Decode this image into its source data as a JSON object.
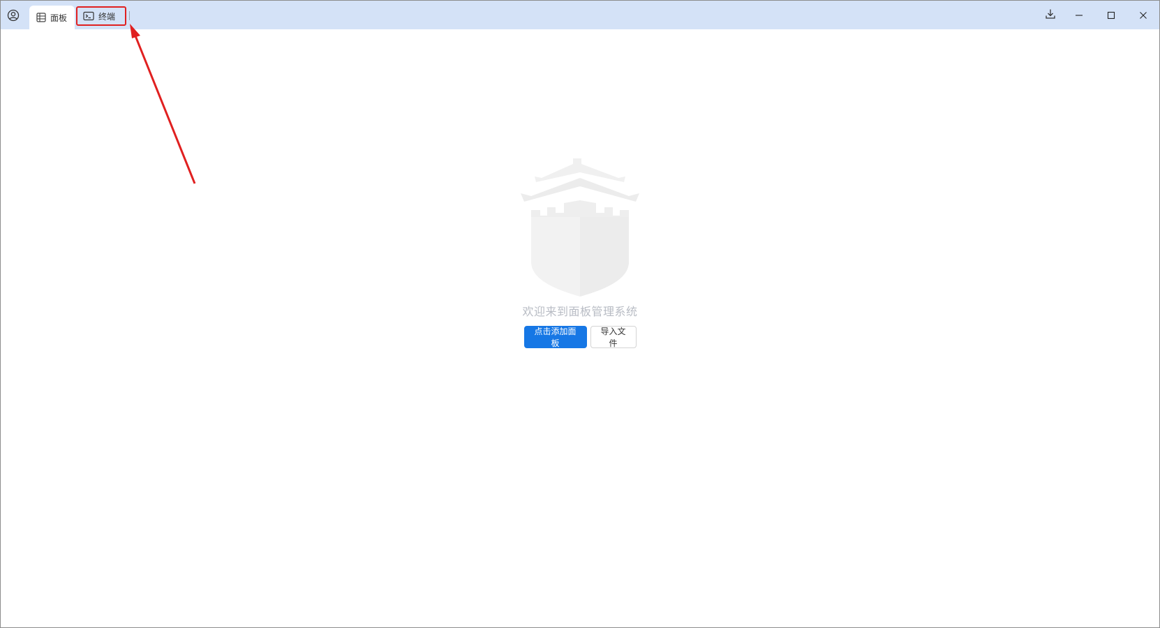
{
  "titlebar": {
    "tabs": [
      {
        "label": "面板",
        "icon": "table-icon",
        "active": true
      },
      {
        "label": "终端",
        "icon": "terminal-icon",
        "active": false
      }
    ],
    "controls": [
      "download-icon",
      "minimize-icon",
      "maximize-icon",
      "close-icon"
    ]
  },
  "main": {
    "welcome_text": "欢迎来到面板管理系统",
    "add_panel_label": "点击添加面板",
    "import_file_label": "导入文件"
  },
  "colors": {
    "titlebar_bg": "#d4e2f7",
    "primary": "#1677e5",
    "highlight": "#e02020"
  }
}
